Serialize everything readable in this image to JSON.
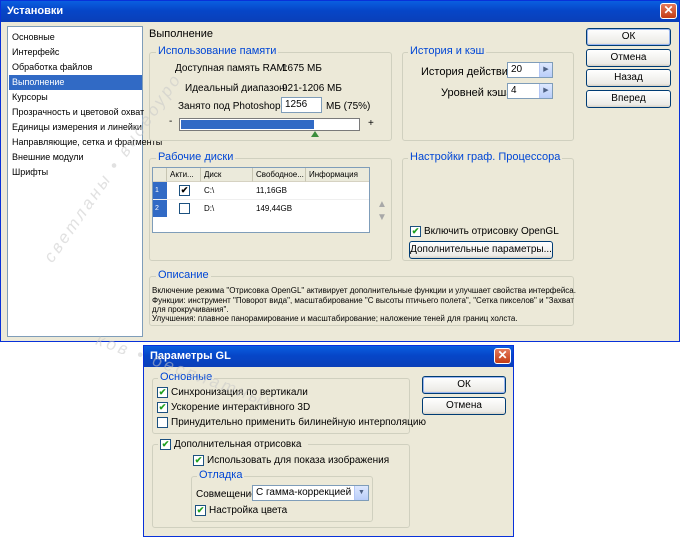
{
  "prefs": {
    "title": "Установки",
    "close_glyph": "✕",
    "nav": [
      "Основные",
      "Интерфейс",
      "Обработка файлов",
      "Выполнение",
      "Курсоры",
      "Прозрачность и цветовой охват",
      "Единицы измерения и линейки",
      "Направляющие, сетка и фрагменты",
      "Внешние модули",
      "Шрифты"
    ],
    "selected_index": 3,
    "panel_title": "Выполнение",
    "buttons": {
      "ok": "ОК",
      "cancel": "Отмена",
      "back": "Назад",
      "next": "Вперед"
    },
    "memory": {
      "title": "Использование памяти",
      "ram_label": "Доступная память RAM:",
      "ram_value": "1675 МБ",
      "ideal_label": "Идеальный диапазон:",
      "ideal_value": "921-1206 МБ",
      "used_label": "Занято под Photoshop:",
      "used_value": "1256",
      "used_unit": "МБ (75%)",
      "minus": "-",
      "plus": "+",
      "slider_fraction": 0.75,
      "fill_color": "#316ac5"
    },
    "history": {
      "title": "История и кэш",
      "actions_label": "История действий:",
      "actions_value": "20",
      "cache_label": "Уровней кэша:",
      "cache_value": "4",
      "arrow": "▶"
    },
    "disks": {
      "title": "Рабочие диски",
      "headers": [
        "Акти...",
        "Диск",
        "Свободное...",
        "Информация"
      ],
      "rows": [
        {
          "num": "1",
          "active": "✔",
          "disk": "C:\\",
          "free": "11,16GB",
          "info": ""
        },
        {
          "num": "2",
          "active": "",
          "disk": "D:\\",
          "free": "149,44GB",
          "info": ""
        }
      ],
      "up": "▲",
      "down": "▼"
    },
    "gpu": {
      "title": "Настройки граф. Процессора",
      "enable_label": "Включить отрисовку OpenGL",
      "enable_check": "✔",
      "advanced_button": "Дополнительные параметры..."
    },
    "description": {
      "title": "Описание",
      "lines": [
        "Включение режима \"Отрисовка OpenGL\" активирует дополнительные функции и улучшает свойства интерфейса.",
        "Функции: инструмент \"Поворот вида\", масштабирование \"С высоты птичьего полета\", \"Сетка пикселов\" и \"Захват",
        "для прокручивания\".",
        "Улучшения: плавное панорамирование и масштабирование; наложение теней для границ холста."
      ]
    }
  },
  "gl": {
    "title": "Параметры GL",
    "close_glyph": "✕",
    "ok": "ОК",
    "cancel": "Отмена",
    "basic": {
      "title": "Основные",
      "vsync": "Синхронизация по вертикали",
      "accel3d": "Ускорение интерактивного 3D",
      "bilinear": "Принудительно применить билинейную интерполяцию"
    },
    "advanced_label": "Дополнительная отрисовка",
    "use_for_display": "Использовать для показа изображения",
    "debug": {
      "title": "Отладка",
      "blend_label": "Совмещение:",
      "blend_value": "С гамма-коррекцией",
      "dropdown_arrow": "▼",
      "color_tuning": "Настройка цвета"
    },
    "check": "✔"
  },
  "watermark": {
    "line1": "светланы • видеоуро",
    "line2": "ков • бесплатных"
  }
}
